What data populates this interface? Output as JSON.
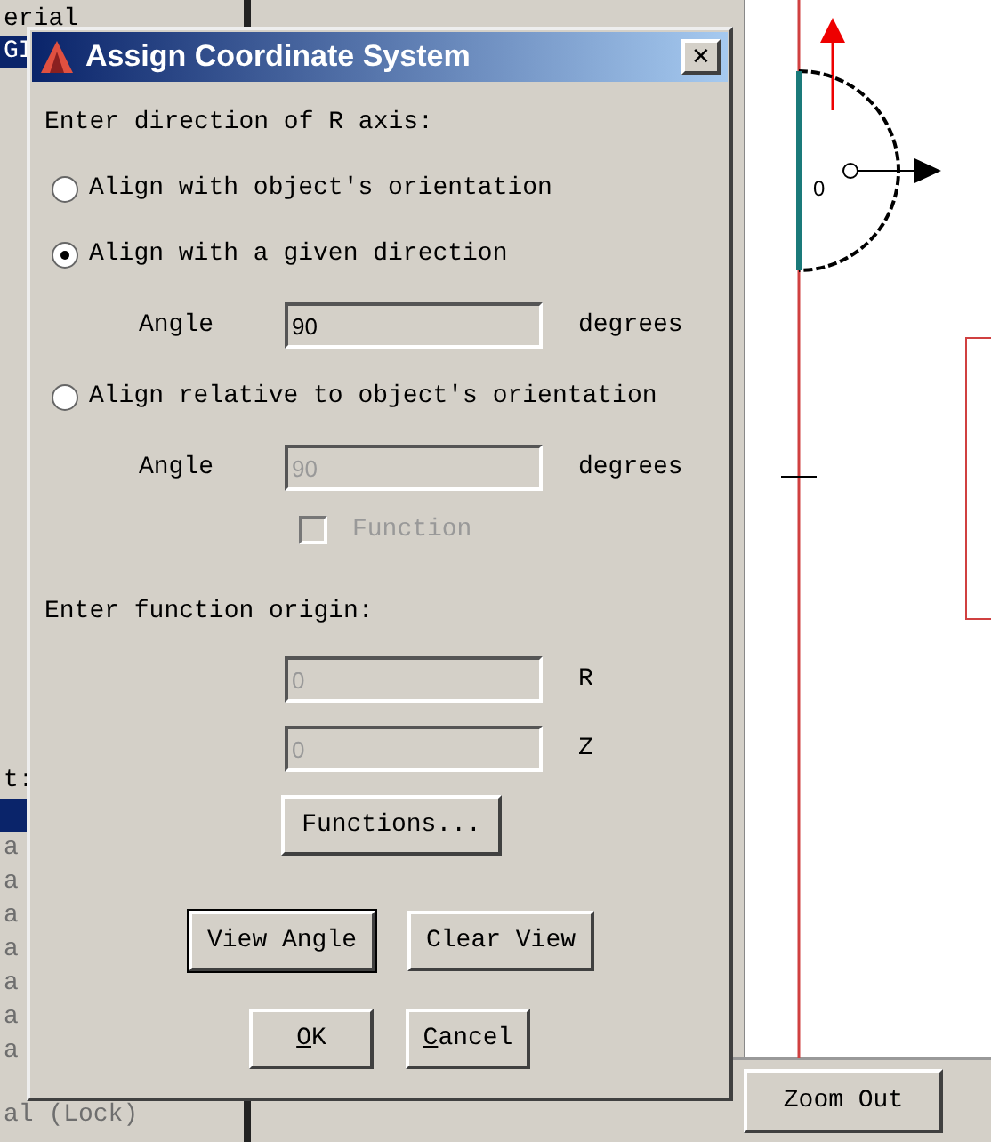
{
  "left_panel": {
    "items": [
      {
        "text": "erial",
        "selected": false
      },
      {
        "text": "GI",
        "selected": true
      }
    ],
    "lower_items": [
      {
        "text": "t:",
        "selected": false
      },
      {
        "selected": true
      },
      {
        "text": "a",
        "selected": false
      },
      {
        "text": "a",
        "selected": false
      },
      {
        "text": "a",
        "selected": false
      },
      {
        "text": "a",
        "selected": false
      },
      {
        "text": "a",
        "selected": false
      },
      {
        "text": "a",
        "selected": false
      },
      {
        "text": "a",
        "selected": false
      },
      {
        "text": "al (Lock)",
        "selected": false
      }
    ]
  },
  "canvas": {
    "origin_label": "0"
  },
  "zoom_out_button": "Zoom Out",
  "dialog": {
    "title": "Assign Coordinate System",
    "close": "✕",
    "direction_heading": "Enter direction of R axis:",
    "options": [
      {
        "label": "Align with object's orientation",
        "selected": false
      },
      {
        "label": "Align with a given direction",
        "selected": true,
        "angle": {
          "label": "Angle",
          "value": "90",
          "unit": "degrees",
          "disabled": false
        }
      },
      {
        "label": "Align relative to object's orientation",
        "selected": false,
        "angle": {
          "label": "Angle",
          "value": "90",
          "unit": "degrees",
          "disabled": true
        },
        "function": {
          "label": "Function",
          "checked": false,
          "disabled": true
        }
      }
    ],
    "origin_heading": "Enter function origin:",
    "origin_fields": [
      {
        "value": "0",
        "unit": "R",
        "disabled": true
      },
      {
        "value": "0",
        "unit": "Z",
        "disabled": true
      }
    ],
    "functions_button": "Functions...",
    "view_buttons": [
      {
        "label": "View Angle",
        "default": true
      },
      {
        "label": "Clear View",
        "default": false
      }
    ],
    "action_buttons": [
      {
        "mnemonic": "O",
        "rest": "K"
      },
      {
        "mnemonic": "C",
        "rest": "ancel"
      }
    ]
  }
}
